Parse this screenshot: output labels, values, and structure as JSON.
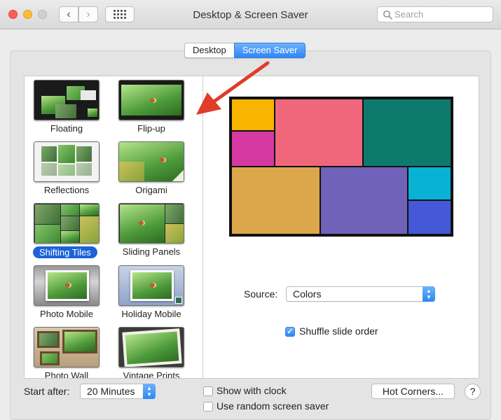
{
  "window": {
    "title": "Desktop & Screen Saver",
    "search_placeholder": "Search"
  },
  "tabs": [
    {
      "label": "Desktop",
      "selected": false
    },
    {
      "label": "Screen Saver",
      "selected": true
    }
  ],
  "screen_savers": [
    {
      "label": "Floating",
      "selected": false
    },
    {
      "label": "Flip-up",
      "selected": false
    },
    {
      "label": "Reflections",
      "selected": false
    },
    {
      "label": "Origami",
      "selected": false
    },
    {
      "label": "Shifting Tiles",
      "selected": true
    },
    {
      "label": "Sliding Panels",
      "selected": false
    },
    {
      "label": "Photo Mobile",
      "selected": false
    },
    {
      "label": "Holiday Mobile",
      "selected": false
    },
    {
      "label": "Photo Wall",
      "selected": false
    },
    {
      "label": "Vintage Prints",
      "selected": false
    }
  ],
  "preview": {
    "colors": [
      "#f7b500",
      "#f0677c",
      "#0e7a6e",
      "#d63aa2",
      "#dca64a",
      "#6f62b8",
      "#08b2d4",
      "#4458d8"
    ]
  },
  "source": {
    "label": "Source:",
    "value": "Colors"
  },
  "shuffle": {
    "label": "Shuffle slide order",
    "checked": true
  },
  "start_after": {
    "label": "Start after:",
    "value": "20 Minutes"
  },
  "show_clock": {
    "label": "Show with clock",
    "checked": false
  },
  "random_saver": {
    "label": "Use random screen saver",
    "checked": false
  },
  "hot_corners_label": "Hot Corners...",
  "help_label": "?",
  "annotation_color": "#e03c2a",
  "accent_color": "#1d63d7"
}
